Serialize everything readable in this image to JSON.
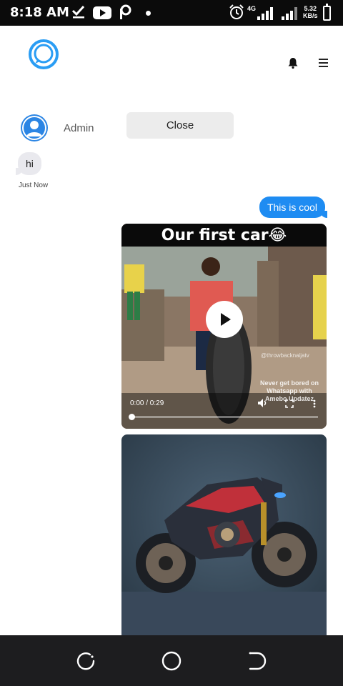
{
  "status_bar": {
    "time": "8:18 AM",
    "network": "4G",
    "speed_value": "5.32",
    "speed_unit": "KB/s",
    "icons": [
      "check-icon",
      "youtube-icon",
      "p-app-icon",
      "dot-icon",
      "alarm-icon",
      "signal-icon",
      "battery-icon"
    ]
  },
  "header": {
    "logo_icon": "chat-ring-logo",
    "accent": "#2a9df4",
    "icons": [
      "bell-icon",
      "menu-icon"
    ]
  },
  "chat": {
    "contact_name": "Admin",
    "close_label": "Close",
    "incoming": {
      "text": "hi",
      "time": "Just Now"
    },
    "outgoing": {
      "text": "This is cool",
      "color": "#1e8cf2"
    }
  },
  "video": {
    "title": "Our first car😂",
    "watermark": "@throwbacknaijatv",
    "overlay_text": "Never get bored on Whatsapp with Amebo Updatez",
    "time_display": "0:00 / 0:29",
    "progress": 0.0
  },
  "image": {
    "subject": "futuristic red and black motorcycle"
  },
  "nav_bar": {
    "icons": [
      "recent-apps-icon",
      "home-icon",
      "back-icon"
    ]
  }
}
